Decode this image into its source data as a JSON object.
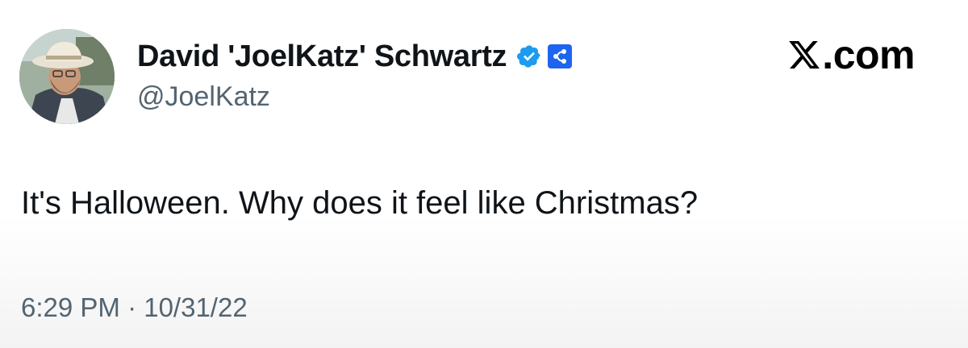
{
  "user": {
    "display_name": "David 'JoelKatz' Schwartz",
    "handle": "@JoelKatz",
    "avatar_icon": "profile-photo-avatar",
    "verified_icon": "verified-badge-icon",
    "affiliate_icon": "ripple-affiliate-badge-icon"
  },
  "brand": {
    "logo_icon": "x-logo-icon",
    "text": ".com"
  },
  "tweet": {
    "text": "It's Halloween. Why does it feel like Christmas?",
    "timestamp": "6:29 PM · 10/31/22"
  },
  "colors": {
    "text_primary": "#0f1419",
    "text_secondary": "#536471",
    "verified_blue": "#1d9bf0",
    "affiliate_blue": "#1d64f0"
  }
}
